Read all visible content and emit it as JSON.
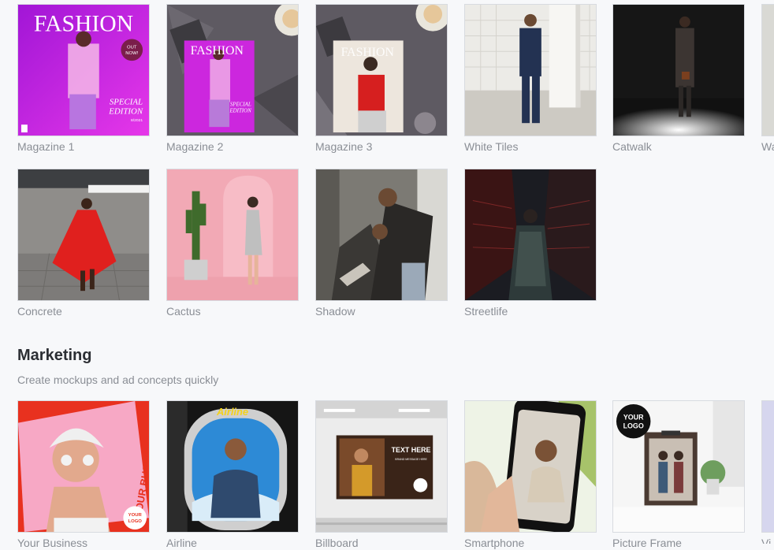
{
  "fashion_templates": [
    {
      "label": "Magazine 1"
    },
    {
      "label": "Magazine 2"
    },
    {
      "label": "Magazine 3"
    },
    {
      "label": "White Tiles"
    },
    {
      "label": "Catwalk"
    },
    {
      "label": "Wa"
    },
    {
      "label": "Concrete"
    },
    {
      "label": "Cactus"
    },
    {
      "label": "Shadow"
    },
    {
      "label": "Streetlife"
    }
  ],
  "magazine": {
    "masthead": "FASHION",
    "badge_line1": "OUT",
    "badge_line2": "NOW!",
    "special_line1": "SPECIAL",
    "special_line2": "EDITION",
    "issue": "8/2021"
  },
  "marketing": {
    "title": "Marketing",
    "subtitle": "Create mockups and ad concepts quickly",
    "templates": [
      {
        "label": "Your Business"
      },
      {
        "label": "Airline"
      },
      {
        "label": "Billboard"
      },
      {
        "label": "Smartphone"
      },
      {
        "label": "Picture Frame"
      },
      {
        "label": "Vi"
      }
    ]
  },
  "mockup_text": {
    "your_business": "YOUR BUSINESS",
    "your_logo_line1": "YOUR",
    "your_logo_line2": "LOGO",
    "airline_brand": "Airline",
    "billboard_headline": "TEXT HERE",
    "billboard_sub": "BRAND MESSAGE HERE"
  },
  "colors": {
    "background": "#f7f8fa",
    "label": "#8a8e95",
    "title": "#2b2e33"
  }
}
